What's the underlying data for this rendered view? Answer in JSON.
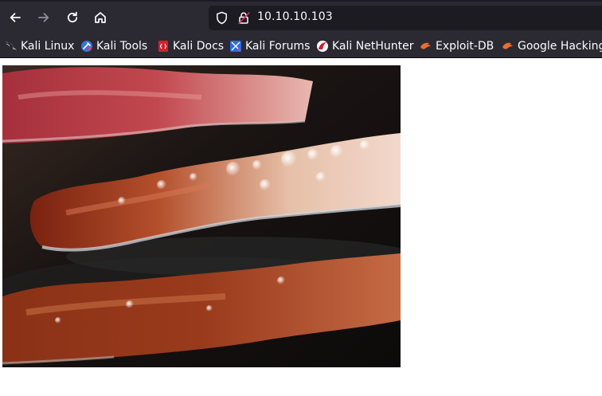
{
  "browser": {
    "url": "10.10.10.103",
    "icons": {
      "back": "arrow-left-icon",
      "forward": "arrow-right-icon",
      "reload": "reload-icon",
      "home": "home-icon",
      "tracking": "shield-icon",
      "security": "insecure-lock-icon"
    }
  },
  "bookmarks": [
    {
      "label": "Kali Linux",
      "icon": "kali-dragon-icon"
    },
    {
      "label": "Kali Tools",
      "icon": "kali-tools-icon"
    },
    {
      "label": "Kali Docs",
      "icon": "kali-docs-icon"
    },
    {
      "label": "Kali Forums",
      "icon": "kali-forums-icon"
    },
    {
      "label": "Kali NetHunter",
      "icon": "kali-nethunter-icon"
    },
    {
      "label": "Exploit-DB",
      "icon": "exploit-db-icon"
    },
    {
      "label": "Google Hacking",
      "icon": "google-hacking-icon"
    }
  ],
  "page": {
    "image": "bacon-photo"
  },
  "colors": {
    "toolbar": "#2b2a33",
    "urlbar": "#1c1b22",
    "text": "#fbfbfe"
  }
}
